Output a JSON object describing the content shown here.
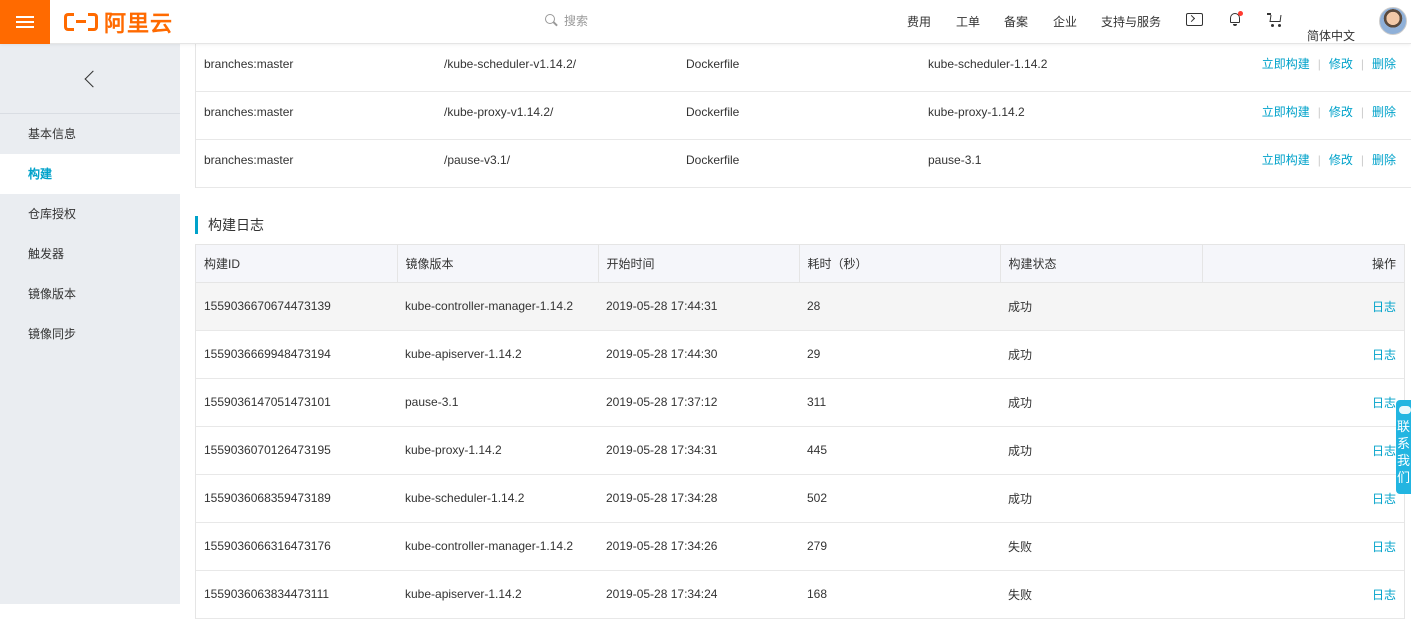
{
  "header": {
    "logo_text": "阿里云",
    "search_placeholder": "搜索",
    "nav": [
      "费用",
      "工单",
      "备案",
      "企业",
      "支持与服务"
    ],
    "language": "简体中文"
  },
  "sidebar": {
    "items": [
      {
        "label": "基本信息",
        "active": false
      },
      {
        "label": "构建",
        "active": true
      },
      {
        "label": "仓库授权",
        "active": false
      },
      {
        "label": "触发器",
        "active": false
      },
      {
        "label": "镜像版本",
        "active": false
      },
      {
        "label": "镜像同步",
        "active": false
      }
    ]
  },
  "rules": {
    "rows": [
      {
        "branch": "branches:master",
        "dir": "/kube-scheduler-v1.14.2/",
        "file": "Dockerfile",
        "tag": "kube-scheduler-1.14.2"
      },
      {
        "branch": "branches:master",
        "dir": "/kube-proxy-v1.14.2/",
        "file": "Dockerfile",
        "tag": "kube-proxy-1.14.2"
      },
      {
        "branch": "branches:master",
        "dir": "/pause-v3.1/",
        "file": "Dockerfile",
        "tag": "pause-3.1"
      }
    ],
    "ops": {
      "build": "立即构建",
      "edit": "修改",
      "delete": "删除",
      "separator": "|"
    }
  },
  "logs": {
    "title": "构建日志",
    "headers": [
      "构建ID",
      "镜像版本",
      "开始时间",
      "耗时（秒）",
      "构建状态",
      "操作"
    ],
    "op_label": "日志",
    "rows": [
      {
        "id": "1559036670674473139",
        "version": "kube-controller-manager-1.14.2",
        "time": "2019-05-28 17:44:31",
        "duration": "28",
        "status": "成功"
      },
      {
        "id": "1559036669948473194",
        "version": "kube-apiserver-1.14.2",
        "time": "2019-05-28 17:44:30",
        "duration": "29",
        "status": "成功"
      },
      {
        "id": "1559036147051473101",
        "version": "pause-3.1",
        "time": "2019-05-28 17:37:12",
        "duration": "311",
        "status": "成功"
      },
      {
        "id": "1559036070126473195",
        "version": "kube-proxy-1.14.2",
        "time": "2019-05-28 17:34:31",
        "duration": "445",
        "status": "成功"
      },
      {
        "id": "1559036068359473189",
        "version": "kube-scheduler-1.14.2",
        "time": "2019-05-28 17:34:28",
        "duration": "502",
        "status": "成功"
      },
      {
        "id": "1559036066316473176",
        "version": "kube-controller-manager-1.14.2",
        "time": "2019-05-28 17:34:26",
        "duration": "279",
        "status": "失败"
      },
      {
        "id": "1559036063834473111",
        "version": "kube-apiserver-1.14.2",
        "time": "2019-05-28 17:34:24",
        "duration": "168",
        "status": "失败"
      }
    ]
  },
  "float_contact": {
    "label": "联系我们"
  },
  "colors": {
    "brand": "#ff6a00",
    "link": "#00a2ca",
    "success": "#22a723",
    "fail": "#e4393c",
    "sidebar_bg": "#eaedf1"
  }
}
